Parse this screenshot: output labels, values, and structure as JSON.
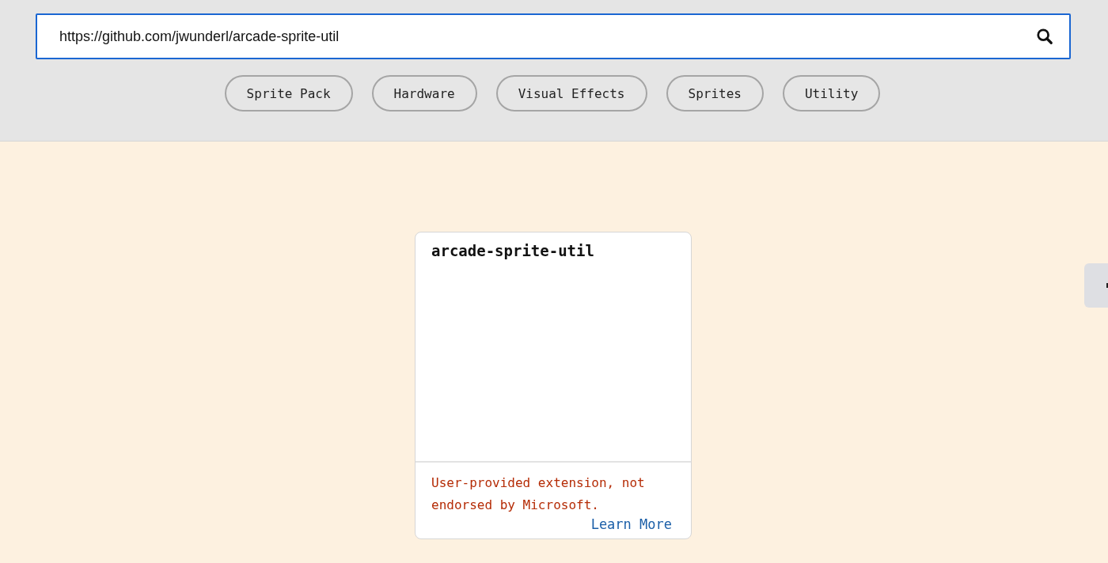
{
  "search": {
    "value": "https://github.com/jwunderl/arcade-sprite-util"
  },
  "tags": [
    {
      "label": "Sprite Pack"
    },
    {
      "label": "Hardware"
    },
    {
      "label": "Visual Effects"
    },
    {
      "label": "Sprites"
    },
    {
      "label": "Utility"
    }
  ],
  "card": {
    "title": "arcade-sprite-util",
    "warning": "User-provided extension, not endorsed by Microsoft.",
    "link": "Learn More"
  }
}
